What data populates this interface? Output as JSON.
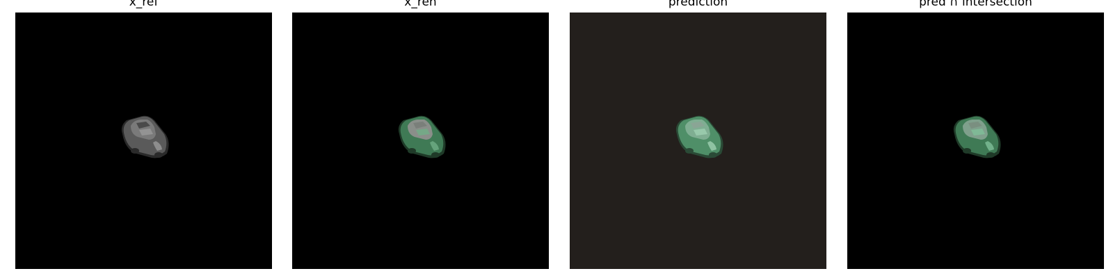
{
  "panels": [
    {
      "title": "x_ref",
      "background": "#000000",
      "car": {
        "body": "#5a5a5a",
        "roof": "#7a7a7a",
        "highlight": "#9a9a9a",
        "shadow": "#2a2a2a",
        "glass": "#4a4a4a"
      }
    },
    {
      "title": "x_ren",
      "background": "#000000",
      "car": {
        "body": "#3f7a55",
        "roof": "#8a8f8a",
        "highlight": "#6fae86",
        "shadow": "#1f3a28",
        "glass": "#7a7f7a"
      }
    },
    {
      "title": "prediction",
      "background": "#231f1c",
      "car": {
        "body": "#4f8f68",
        "roof": "#7fae92",
        "highlight": "#9fd0b2",
        "shadow": "#2a4a36",
        "glass": "#8aa595"
      }
    },
    {
      "title": "pred ∩ intersection",
      "background": "#000000",
      "car": {
        "body": "#3f7a55",
        "roof": "#7fa08c",
        "highlight": "#7fbf98",
        "shadow": "#1f3a28",
        "glass": "#7a8f80"
      }
    }
  ]
}
